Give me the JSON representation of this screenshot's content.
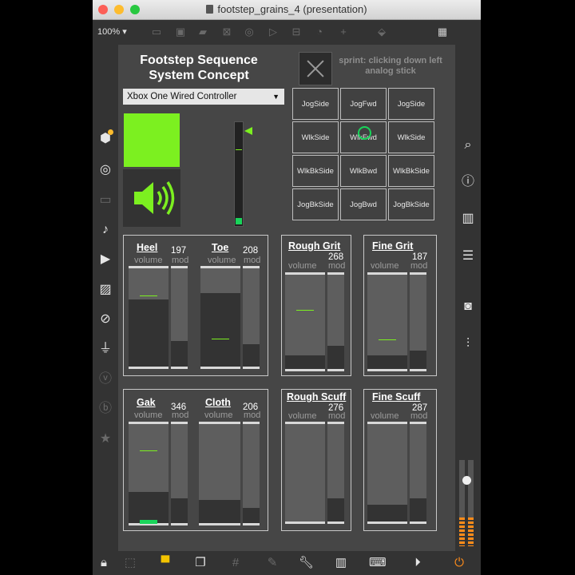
{
  "window": {
    "title": "footstep_grains_4 (presentation)"
  },
  "toolbar": {
    "zoom": "100%"
  },
  "heading": {
    "line1": "Footstep Sequence",
    "line2": "System Concept"
  },
  "sprint": {
    "text": "sprint: clicking down left analog stick"
  },
  "controller": {
    "selected": "Xbox One Wired Controller"
  },
  "grid": {
    "cells": [
      "JogSide",
      "JogFwd",
      "JogSide",
      "WlkSide",
      "WlkFwd",
      "WlkSide",
      "WlkBkSide",
      "WlkBwd",
      "WlkBkSide",
      "JogBkSide",
      "JogBwd",
      "JogBkSide"
    ],
    "active_cell": "WlkFwd"
  },
  "panels": {
    "heel": {
      "label": "Heel",
      "value": "197",
      "sub1": "volume",
      "sub2": "mod"
    },
    "toe": {
      "label": "Toe",
      "value": "208",
      "sub1": "volume",
      "sub2": "mod"
    },
    "rough_grit": {
      "label": "Rough Grit",
      "value": "268",
      "sub1": "volume",
      "sub2": "mod"
    },
    "fine_grit": {
      "label": "Fine Grit",
      "value": "187",
      "sub1": "volume",
      "sub2": "mod"
    },
    "gak": {
      "label": "Gak",
      "value": "346",
      "sub1": "volume",
      "sub2": "mod"
    },
    "cloth": {
      "label": "Cloth",
      "value": "206",
      "sub1": "volume",
      "sub2": "mod"
    },
    "rough_scuff": {
      "label": "Rough Scuff",
      "value": "276",
      "sub1": "volume",
      "sub2": "mod"
    },
    "fine_scuff": {
      "label": "Fine Scuff",
      "value": "287",
      "sub1": "volume",
      "sub2": "mod"
    }
  },
  "colors": {
    "accent_green": "#7cf020",
    "meter_orange": "#ff8c1a",
    "close": "#fc5f57",
    "minimize": "#fdbc2e",
    "zoom": "#28c840"
  },
  "icons": {
    "left": [
      "cube-icon",
      "target-icon",
      "screen-icon",
      "music-note-icon",
      "video-icon",
      "image-icon",
      "paperclip-icon",
      "plug-icon",
      "v-badge-icon",
      "b-badge-icon",
      "star-icon"
    ],
    "right": [
      "search-icon",
      "info-icon",
      "book-icon",
      "list-icon",
      "camera-icon",
      "mixer-icon"
    ]
  }
}
